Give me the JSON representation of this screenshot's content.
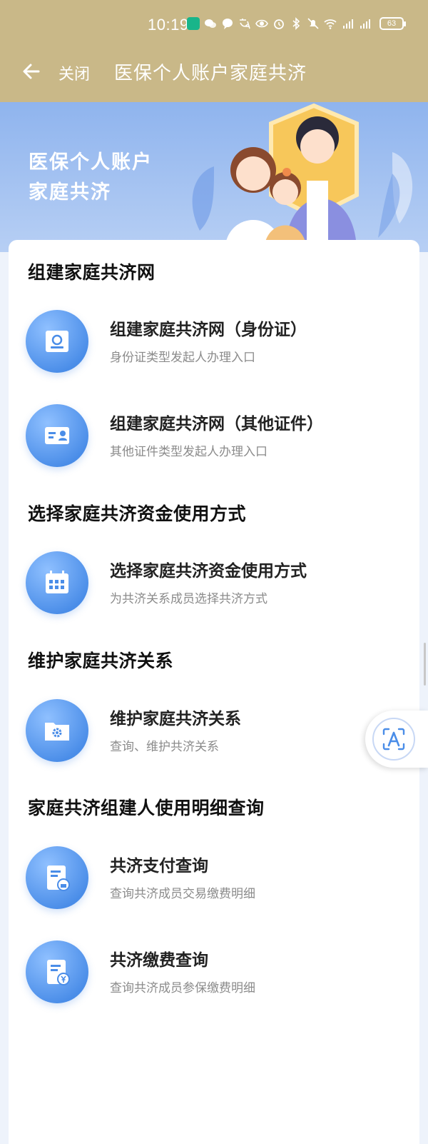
{
  "status_bar": {
    "time": "10:19",
    "battery": "63",
    "icons": [
      "app-badge-icon",
      "wechat-icon",
      "chat-icon",
      "translate-icon",
      "eye-icon",
      "alarm-icon",
      "bluetooth-icon",
      "mute-icon",
      "wifi-icon",
      "signal-5g-icon",
      "signal-4g-icon"
    ]
  },
  "nav": {
    "close_label": "关闭",
    "title": "医保个人账户家庭共济"
  },
  "banner": {
    "line1": "医保个人账户",
    "line2": "家庭共济"
  },
  "sections": [
    {
      "title": "组建家庭共济网",
      "items": [
        {
          "title": "组建家庭共济网（身份证）",
          "subtitle": "身份证类型发起人办理入口",
          "icon": "id-card-icon"
        },
        {
          "title": "组建家庭共济网（其他证件）",
          "subtitle": "其他证件类型发起人办理入口",
          "icon": "document-card-icon"
        }
      ]
    },
    {
      "title": "选择家庭共济资金使用方式",
      "items": [
        {
          "title": "选择家庭共济资金使用方式",
          "subtitle": "为共济关系成员选择共济方式",
          "icon": "calendar-icon"
        }
      ]
    },
    {
      "title": "维护家庭共济关系",
      "items": [
        {
          "title": "维护家庭共济关系",
          "subtitle": "查询、维护共济关系",
          "icon": "folder-gear-icon"
        }
      ]
    },
    {
      "title": "家庭共济组建人使用明细查询",
      "items": [
        {
          "title": "共济支付查询",
          "subtitle": "查询共济成员交易缴费明细",
          "icon": "payment-record-icon"
        },
        {
          "title": "共济缴费查询",
          "subtitle": "查询共济成员参保缴费明细",
          "icon": "yuan-record-icon"
        }
      ]
    }
  ],
  "colors": {
    "header_bg": "#c9b888",
    "icon_blue": "#4a8de8",
    "banner_top": "#8fb4ee"
  }
}
